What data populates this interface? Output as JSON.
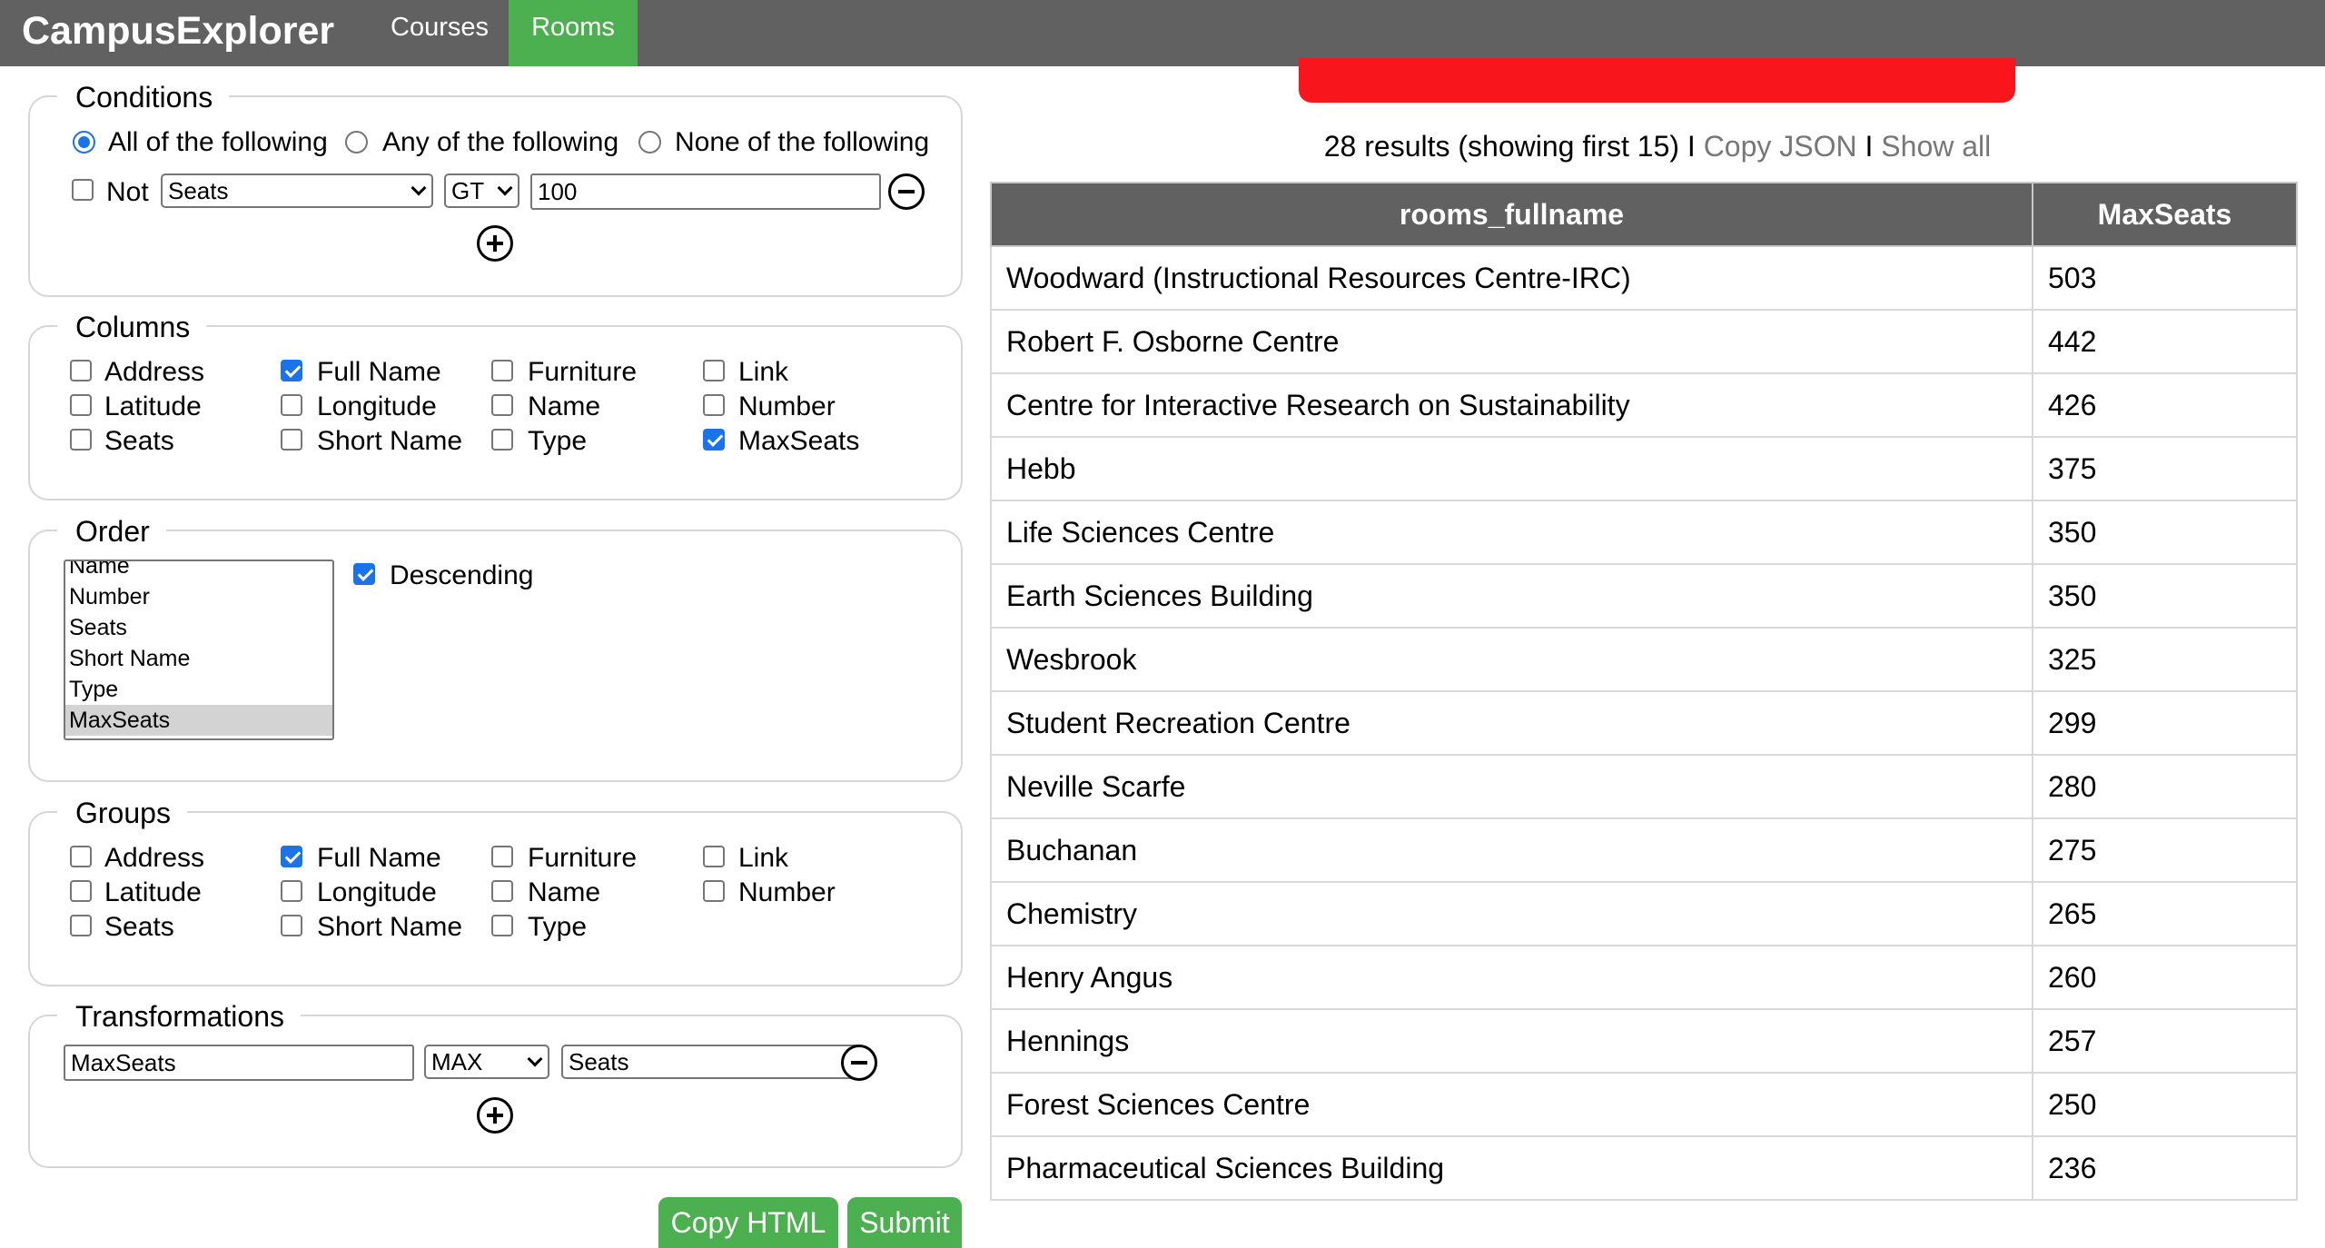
{
  "nav": {
    "brand": "CampusExplorer",
    "tabs": [
      {
        "label": "Courses",
        "active": false
      },
      {
        "label": "Rooms",
        "active": true
      }
    ]
  },
  "conditions": {
    "legend": "Conditions",
    "modes": [
      {
        "label": "All of the following",
        "checked": true
      },
      {
        "label": "Any of the following",
        "checked": false
      },
      {
        "label": "None of the following",
        "checked": false
      }
    ],
    "row": {
      "not_label": "Not",
      "not_checked": false,
      "field": "Seats",
      "operator": "GT",
      "value": "100"
    }
  },
  "columns": {
    "legend": "Columns",
    "items": [
      {
        "label": "Address",
        "checked": false
      },
      {
        "label": "Full Name",
        "checked": true
      },
      {
        "label": "Furniture",
        "checked": false
      },
      {
        "label": "Link",
        "checked": false
      },
      {
        "label": "Latitude",
        "checked": false
      },
      {
        "label": "Longitude",
        "checked": false
      },
      {
        "label": "Name",
        "checked": false
      },
      {
        "label": "Number",
        "checked": false
      },
      {
        "label": "Seats",
        "checked": false
      },
      {
        "label": "Short Name",
        "checked": false
      },
      {
        "label": "Type",
        "checked": false
      },
      {
        "label": "MaxSeats",
        "checked": true
      }
    ]
  },
  "order": {
    "legend": "Order",
    "options": [
      "Name",
      "Number",
      "Seats",
      "Short Name",
      "Type",
      "MaxSeats"
    ],
    "selected": "MaxSeats",
    "descending_label": "Descending",
    "descending_checked": true
  },
  "groups": {
    "legend": "Groups",
    "items": [
      {
        "label": "Address",
        "checked": false
      },
      {
        "label": "Full Name",
        "checked": true
      },
      {
        "label": "Furniture",
        "checked": false
      },
      {
        "label": "Link",
        "checked": false
      },
      {
        "label": "Latitude",
        "checked": false
      },
      {
        "label": "Longitude",
        "checked": false
      },
      {
        "label": "Name",
        "checked": false
      },
      {
        "label": "Number",
        "checked": false
      },
      {
        "label": "Seats",
        "checked": false
      },
      {
        "label": "Short Name",
        "checked": false
      },
      {
        "label": "Type",
        "checked": false
      }
    ]
  },
  "transformations": {
    "legend": "Transformations",
    "row": {
      "name": "MaxSeats",
      "apply": "MAX",
      "field": "Seats"
    }
  },
  "actions": {
    "copy_html": "Copy HTML",
    "submit": "Submit"
  },
  "results": {
    "summary": "28 results (showing first 15)",
    "separator": "I",
    "copy_json": "Copy JSON",
    "show_all": "Show all",
    "headers": [
      "rooms_fullname",
      "MaxSeats"
    ],
    "rows": [
      [
        "Woodward (Instructional Resources Centre-IRC)",
        "503"
      ],
      [
        "Robert F. Osborne Centre",
        "442"
      ],
      [
        "Centre for Interactive Research on Sustainability",
        "426"
      ],
      [
        "Hebb",
        "375"
      ],
      [
        "Life Sciences Centre",
        "350"
      ],
      [
        "Earth Sciences Building",
        "350"
      ],
      [
        "Wesbrook",
        "325"
      ],
      [
        "Student Recreation Centre",
        "299"
      ],
      [
        "Neville Scarfe",
        "280"
      ],
      [
        "Buchanan",
        "275"
      ],
      [
        "Chemistry",
        "265"
      ],
      [
        "Henry Angus",
        "260"
      ],
      [
        "Hennings",
        "257"
      ],
      [
        "Forest Sciences Centre",
        "250"
      ],
      [
        "Pharmaceutical Sciences Building",
        "236"
      ]
    ]
  },
  "colors": {
    "nav_bg": "#616161",
    "active_tab": "#4caf50",
    "error_bar": "#f8151c",
    "accent": "#1a73e8"
  }
}
